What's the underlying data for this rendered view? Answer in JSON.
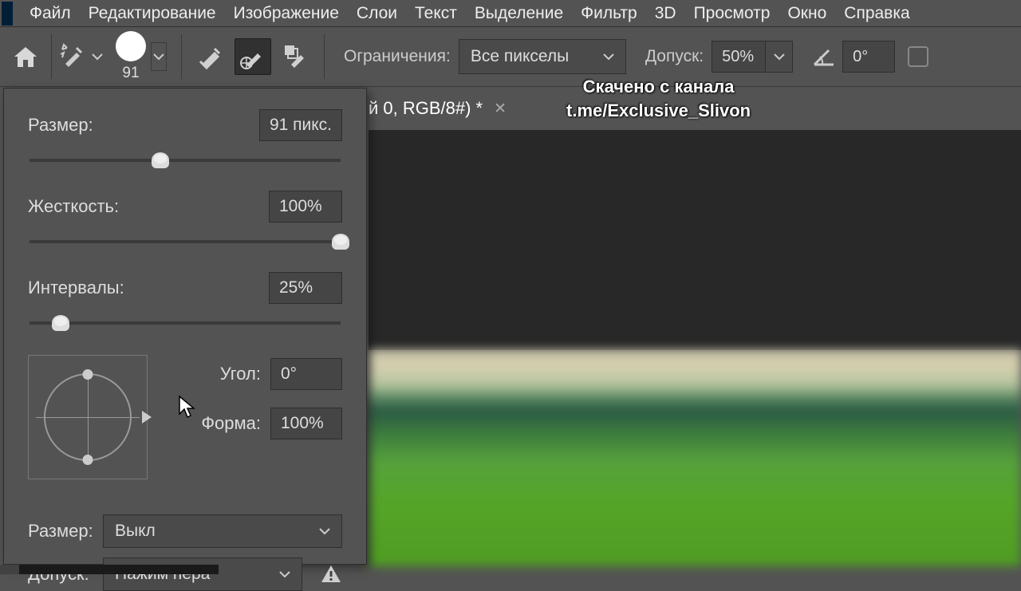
{
  "menu": {
    "items": [
      "Файл",
      "Редактирование",
      "Изображение",
      "Слои",
      "Текст",
      "Выделение",
      "Фильтр",
      "3D",
      "Просмотр",
      "Окно",
      "Справка"
    ]
  },
  "options": {
    "brush_size": "91",
    "limits_label": "Ограничения:",
    "limits_value": "Все пикселы",
    "tolerance_label": "Допуск:",
    "tolerance_value": "50%",
    "angle_value": "0°"
  },
  "tab": {
    "title_suffix": "й 0, RGB/8#) *"
  },
  "watermark": {
    "line1": "Скачено с канала",
    "line2": "t.me/Exclusive_Slivon"
  },
  "panel": {
    "size_label": "Размер:",
    "size_value": "91 пикс.",
    "size_pct": 42,
    "hardness_label": "Жесткость:",
    "hardness_value": "100%",
    "hardness_pct": 100,
    "spacing_label": "Интервалы:",
    "spacing_value": "25%",
    "spacing_pct": 10,
    "angle_label": "Угол:",
    "angle_value": "0°",
    "roundness_label": "Форма:",
    "roundness_value": "100%",
    "dyn_size_label": "Размер:",
    "dyn_size_value": "Выкл",
    "dyn_tol_label": "Допуск:",
    "dyn_tol_value": "Нажим пера"
  }
}
